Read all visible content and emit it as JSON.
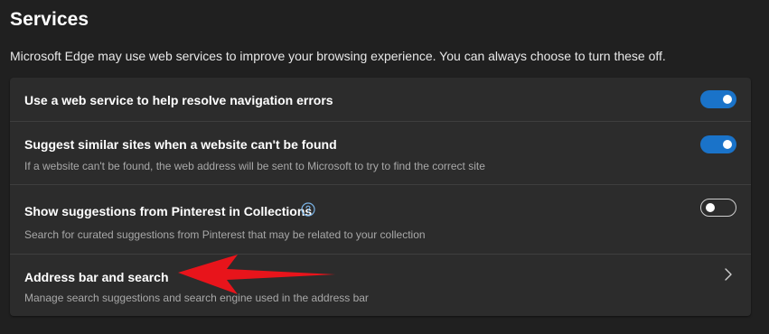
{
  "section": {
    "title": "Services",
    "description": "Microsoft Edge may use web services to improve your browsing experience. You can always choose to turn these off."
  },
  "settings": [
    {
      "title": "Use a web service to help resolve navigation errors",
      "subtitle": "",
      "control": "toggle",
      "enabled": true
    },
    {
      "title": "Suggest similar sites when a website can't be found",
      "subtitle": "If a website can't be found, the web address will be sent to Microsoft to try to find the correct site",
      "control": "toggle",
      "enabled": true
    },
    {
      "title": "Show suggestions from Pinterest in Collections",
      "subtitle": "Search for curated suggestions from Pinterest that may be related to your collection",
      "control": "toggle",
      "enabled": false,
      "help_icon": "question-circle-icon"
    },
    {
      "title": "Address bar and search",
      "subtitle": "Manage search suggestions and search engine used in the address bar",
      "control": "chevron",
      "icon": "chevron-right-icon"
    }
  ],
  "annotation": {
    "icon": "red-arrow-pointer",
    "color": "#e8141b"
  },
  "colors": {
    "accent": "#1a73c9",
    "background": "#202020",
    "card": "#2c2c2c"
  }
}
